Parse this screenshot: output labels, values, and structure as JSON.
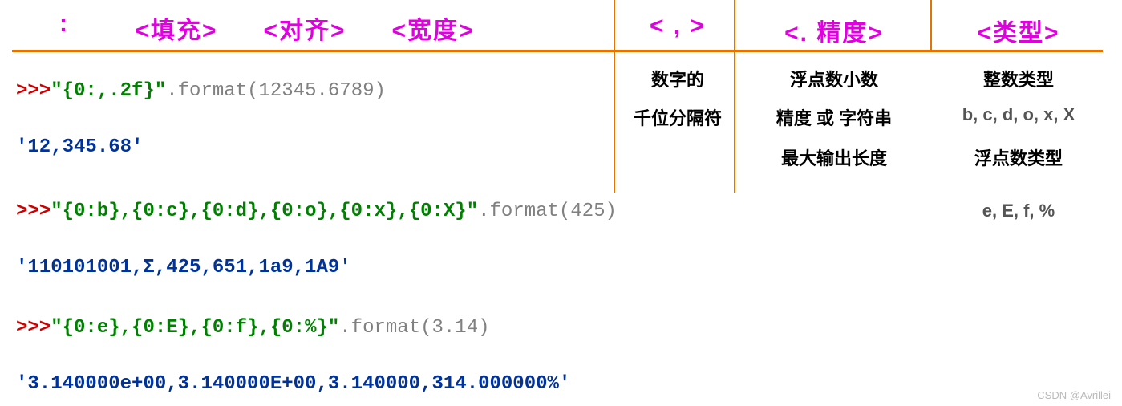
{
  "header": {
    "colon": ":",
    "fill": "<填充>",
    "align": "<对齐>",
    "width": "<宽度>",
    "comma": "< , >",
    "precision": "<. 精度>",
    "type": "<类型>"
  },
  "notes": {
    "col2_l1": "数字的",
    "col2_l2": "千位分隔符",
    "col3_l1": "浮点数小数",
    "col3_l2": "精度 或 字符串",
    "col3_l3": "最大输出长度",
    "col4_l1": "整数类型",
    "col4_l2": "b, c, d, o, x, X",
    "col4_l3": "浮点数类型",
    "col4_l4": "e, E, f, %"
  },
  "code": {
    "prompt": ">>>",
    "ex1_str": "\"{0:,.2f}\"",
    "ex1_call": ".format(12345.6789)",
    "ex1_out": "'12,345.68'",
    "ex2_str": "\"{0:b},{0:c},{0:d},{0:o},{0:x},{0:X}\"",
    "ex2_call": ".format(425)",
    "ex2_out": "'110101001,Σ,425,651,1a9,1A9'",
    "ex3_str": "\"{0:e},{0:E},{0:f},{0:%}\"",
    "ex3_call": ".format(3.14)",
    "ex3_out": "'3.140000e+00,3.140000E+00,3.140000,314.000000%'"
  },
  "watermark": "CSDN @Avrillei"
}
